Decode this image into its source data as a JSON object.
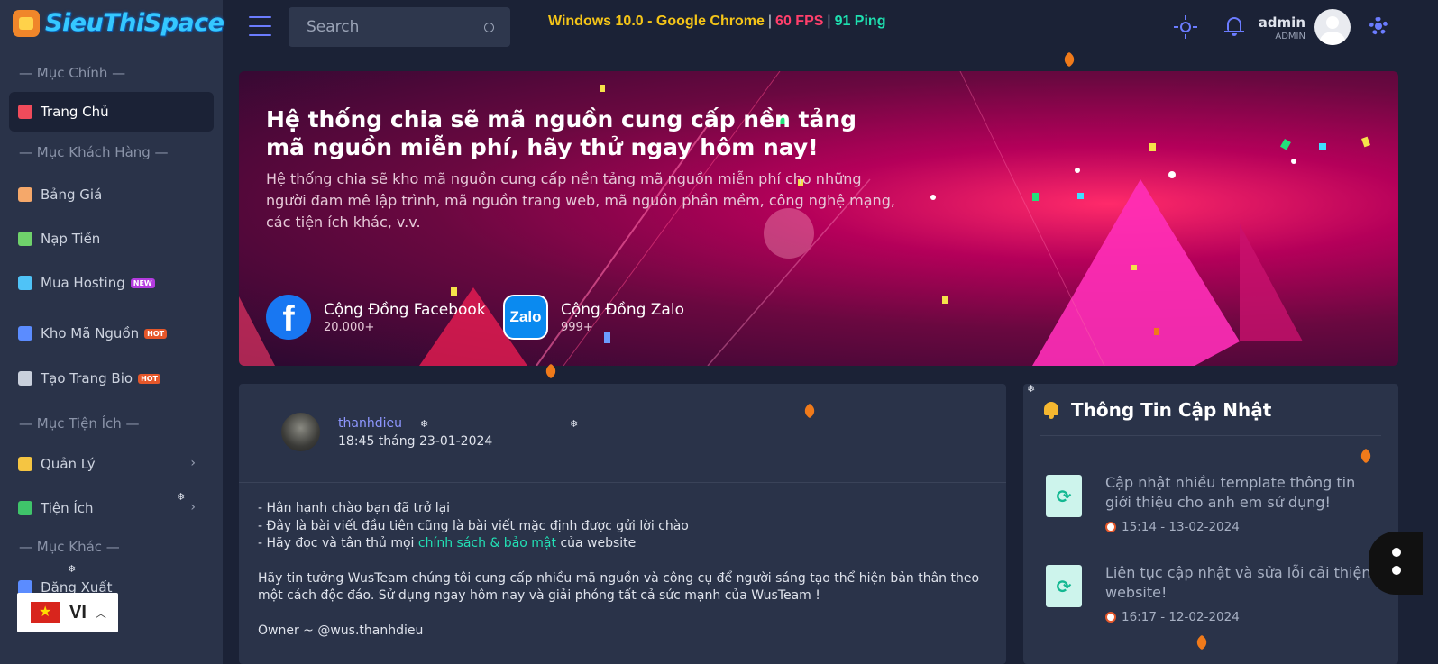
{
  "brand": {
    "name": "SieuThiSpace"
  },
  "header": {
    "search_placeholder": "Search",
    "sysinfo": {
      "browser": "Windows 10.0 - Google Chrome",
      "sep": "|",
      "fps": "60 FPS",
      "ping": "91 Ping"
    },
    "user": {
      "name": "admin",
      "role": "ADMIN"
    }
  },
  "sidebar": {
    "sections": {
      "main": "— Mục Chính —",
      "customer": "— Mục Khách Hàng —",
      "utility": "— Mục Tiện Ích —",
      "other": "— Mục Khác —"
    },
    "items": [
      {
        "label": "Trang Chủ",
        "icon": "home-icon",
        "color": "#f04b5b"
      },
      {
        "label": "Bảng Giá",
        "icon": "price-icon",
        "color": "#f5a86a"
      },
      {
        "label": "Nạp Tiền",
        "icon": "money-icon",
        "color": "#6fd26b"
      },
      {
        "label": "Mua Hosting",
        "icon": "cloud-icon",
        "color": "#4fc3f7",
        "badge": "NEW"
      },
      {
        "label": "Kho Mã Nguồn",
        "icon": "code-icon",
        "color": "#5b8cff",
        "badge": "HOT"
      },
      {
        "label": "Tạo Trang Bio",
        "icon": "bio-icon",
        "color": "#c9d0dc",
        "badge": "HOT"
      },
      {
        "label": "Quản Lý",
        "icon": "tools-icon",
        "color": "#f5c542"
      },
      {
        "label": "Tiện Ích",
        "icon": "clover-icon",
        "color": "#3fc46a"
      },
      {
        "label": "Đăng Xuất",
        "icon": "logout-icon",
        "color": "#5b8cff"
      }
    ],
    "language": {
      "code": "VI"
    }
  },
  "banner": {
    "title": "Hệ thống chia sẽ mã nguồn cung cấp nền tảng mã nguồn miễn phí, hãy thử ngay hôm nay!",
    "description": "Hệ thống chia sẽ kho mã nguồn cung cấp nền tảng mã nguồn miễn phí cho những người đam mê lập trình, mã nguồn trang web, mã nguồn phần mềm, công nghệ mạng, các tiện ích khác, v.v.",
    "communities": [
      {
        "title": "Cộng Đồng Facebook",
        "count": "20.000+",
        "logo": "f"
      },
      {
        "title": "Cộng Đồng Zalo",
        "count": "999+",
        "logo": "Zalo"
      }
    ]
  },
  "post": {
    "author": "thanhdieu",
    "time": "18:45 tháng 23-01-2024",
    "lines": [
      "- Hân hạnh chào bạn đã trở lại",
      "- Đây là bài viết đầu tiên cũng là bài viết mặc định được gửi lời chào"
    ],
    "policy_prefix": "- Hãy đọc và tân thủ mọi ",
    "policy_link": "chính sách & bảo mật",
    "policy_suffix": " của website",
    "paragraph": "Hãy tin tưởng WusTeam chúng tôi cung cấp nhiều mã nguồn và công cụ để người sáng tạo thể hiện bản thân theo một cách độc đáo. Sử dụng ngay hôm nay và giải phóng tất cả sức mạnh của WusTeam !",
    "owner": "Owner ~ @wus.thanhdieu"
  },
  "updates": {
    "title": "Thông Tin Cập Nhật",
    "items": [
      {
        "text": "Cập nhật nhiều template thông tin giới thiệu cho anh em sử dụng!",
        "time": "15:14 - 13-02-2024"
      },
      {
        "text": "Liên tục cập nhật và sửa lỗi cải thiện website!",
        "time": "16:17 - 12-02-2024"
      }
    ]
  }
}
